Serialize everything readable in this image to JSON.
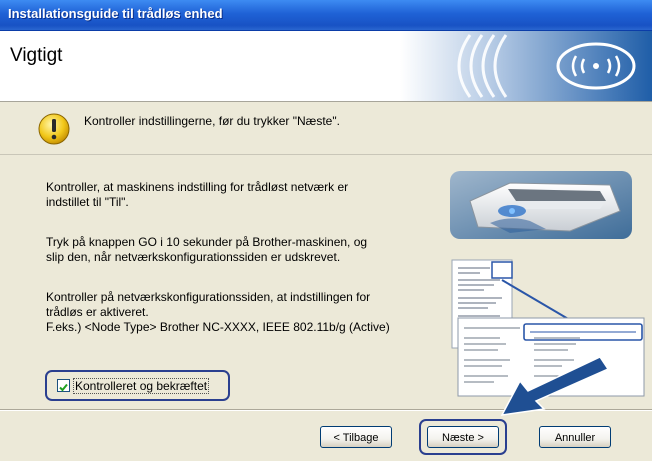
{
  "window": {
    "title": "Installationsguide til trådløs enhed"
  },
  "header": {
    "title": "Vigtigt"
  },
  "notice": {
    "text": "Kontroller indstillingerne, før du trykker \"Næste\"."
  },
  "body": {
    "p1_line1": "Kontroller, at maskinens indstilling for trådløst netværk er",
    "p1_line2": "indstillet til \"Til\".",
    "p2_line1": "Tryk på knappen GO i 10 sekunder på Brother-maskinen, og",
    "p2_line2": "slip den, når netværkskonfigurationssiden er udskrevet.",
    "p3_line1": "Kontroller på netværkskonfigurationssiden, at indstillingen for",
    "p3_line2": "trådløs er aktiveret.",
    "p3_line3": "F.eks.) <Node Type> Brother NC-XXXX, IEEE 802.11b/g (Active)"
  },
  "confirm": {
    "label": "Kontrolleret og bekræftet",
    "checked": true
  },
  "buttons": {
    "back": "< Tilbage",
    "next": "Næste >",
    "cancel": "Annuller"
  },
  "colors": {
    "titlebar": "#1f62d6",
    "accent": "#2a3f8f",
    "arrow": "#1f4f93"
  }
}
